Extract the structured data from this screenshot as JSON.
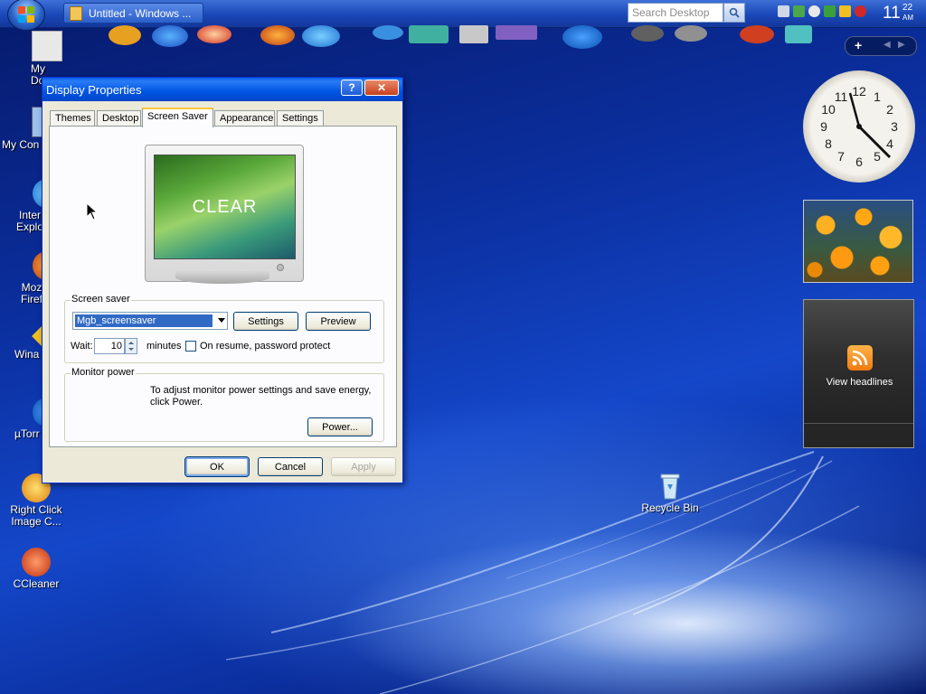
{
  "taskbar": {
    "task_title": "Untitled - Windows ...",
    "search_placeholder": "Search Desktop",
    "clock_hour": "11",
    "clock_minute": "22",
    "clock_ampm": "AM"
  },
  "desktop_icons": [
    {
      "label": "My Docum"
    },
    {
      "label": "My Con"
    },
    {
      "label": "Inter Explo"
    },
    {
      "label": "Moz Firef"
    },
    {
      "label": "Wina"
    },
    {
      "label": "µTorr"
    },
    {
      "label": "Right Click Image C..."
    },
    {
      "label": "CCleaner"
    },
    {
      "label": "Recycle Bin"
    }
  ],
  "dialog": {
    "title": "Display Properties",
    "help_label": "?",
    "close_label": "✕",
    "tabs": [
      {
        "label": "Themes"
      },
      {
        "label": "Desktop"
      },
      {
        "label": "Screen Saver"
      },
      {
        "label": "Appearance"
      },
      {
        "label": "Settings"
      }
    ],
    "preview_text": "CLEAR",
    "screen_saver": {
      "group_label": "Screen saver",
      "selected": "Mgb_screensaver",
      "settings_label": "Settings",
      "preview_label": "Preview",
      "wait_label": "Wait:",
      "wait_value": "10",
      "minutes_label": "minutes",
      "password_label": "On resume, password protect"
    },
    "monitor_power": {
      "group_label": "Monitor power",
      "description_line1": "To adjust monitor power settings and save energy,",
      "description_line2": "click Power.",
      "power_label": "Power..."
    },
    "ok_label": "OK",
    "cancel_label": "Cancel",
    "apply_label": "Apply"
  },
  "sidebar": {
    "add_label": "+",
    "feed_label": "View headlines"
  },
  "colors": {
    "titlebar": "#0054e3",
    "selection": "#316ac5",
    "desktop": "#0b2f9f"
  }
}
